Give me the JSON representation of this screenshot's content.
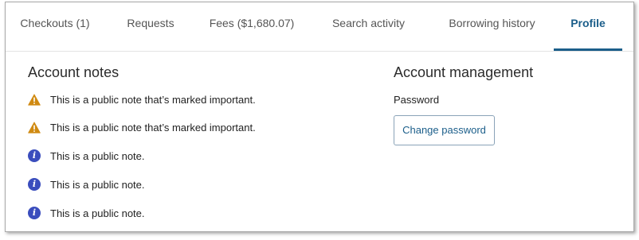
{
  "tabs": [
    {
      "label": "Checkouts (1)",
      "active": false
    },
    {
      "label": "Requests",
      "active": false
    },
    {
      "label": "Fees ($1,680.07)",
      "active": false
    },
    {
      "label": "Search activity",
      "active": false
    },
    {
      "label": "Borrowing history",
      "active": false
    },
    {
      "label": "Profile",
      "active": true
    }
  ],
  "account_notes": {
    "title": "Account notes",
    "notes": [
      {
        "icon": "warning-icon",
        "text": "This is a public note that’s marked important."
      },
      {
        "icon": "warning-icon",
        "text": "This is a public note that’s marked important."
      },
      {
        "icon": "info-icon",
        "text": "This is a public note."
      },
      {
        "icon": "info-icon",
        "text": "This is a public note."
      },
      {
        "icon": "info-icon",
        "text": "This is a public note."
      }
    ]
  },
  "account_management": {
    "title": "Account management",
    "password_label": "Password",
    "change_password_label": "Change password"
  },
  "colors": {
    "accent": "#1b5e8a",
    "warning": "#d08a12",
    "info": "#3a4dbd"
  }
}
